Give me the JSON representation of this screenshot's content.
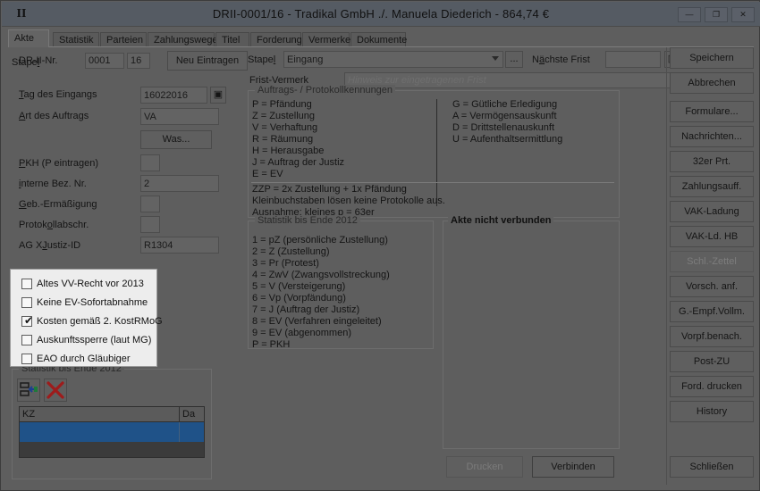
{
  "window": {
    "title": "DRII-0001/16 - Tradikal GmbH ./. Manuela Diederich - 864,74 €",
    "pin_icon": "II",
    "controls": {
      "minimize": "—",
      "maximize": "❐",
      "close": "✕"
    }
  },
  "tabs": [
    {
      "label": "Akte",
      "active": true
    },
    {
      "label": "Statistik",
      "active": false
    },
    {
      "label": "Parteien",
      "active": false
    },
    {
      "label": "Zahlungswege",
      "active": false
    },
    {
      "label": "Titel",
      "active": false
    },
    {
      "label": "Forderung",
      "active": false
    },
    {
      "label": "Vermerke",
      "active": false
    },
    {
      "label": "Dokumente",
      "active": false
    }
  ],
  "form": {
    "drii_label": "DR-II-Nr.",
    "drii_no": "0001",
    "drii_year": "16",
    "neu_eintragen": "Neu Eintragen",
    "tag_eingangs_label": "Tag des Eingangs",
    "tag_eingangs_value": "16022016",
    "art_auftrags_label": "Art des Auftrags",
    "art_auftrags_value": "VA",
    "was_button": "Was...",
    "pkh_label": "PKH (P eintragen)",
    "pkh_value": "",
    "interne_bez_label": "interne Bez. Nr.",
    "interne_bez_value": "2",
    "geb_ermaessigung_label": "Geb.-Ermäßigung",
    "geb_ermaessigung_value": "",
    "protokollabschr_label": "Protokollabschr.",
    "protokollabschr_value": "",
    "ag_xjustiz_label": "AG XJustiz-ID",
    "ag_xjustiz_value": "R1304"
  },
  "stapel": {
    "label": "Stapel",
    "value": "Eingang",
    "ellipsis_button": "...",
    "naechste_frist_label": "Nächste Frist",
    "naechste_frist_value": "",
    "calendar_icon": "calendar-icon"
  },
  "frist_vermerk": {
    "label": "Frist-Vermerk",
    "placeholder": "Hinweis zur eingetragenen Frist",
    "value": ""
  },
  "kennungen": {
    "title": "Auftrags- / Protokollkennungen",
    "left_column": [
      "P = Pfändung",
      "Z = Zustellung",
      "V = Verhaftung",
      "R = Räumung",
      "H = Herausgabe",
      "J = Auftrag der Justiz",
      "E = EV"
    ],
    "right_column": [
      "G = Gütliche Erledigung",
      "A = Vermögensauskunft",
      "D = Drittstellenauskunft",
      "U = Aufenthaltsermittlung"
    ],
    "footnotes": [
      "ZZP = 2x Zustellung + 1x Pfändung",
      "Kleinbuchstaben lösen keine Protokolle aus.",
      "Ausnahme: kleines p = 63er"
    ]
  },
  "statistik_legend": {
    "title": "Statistik bis Ende 2012",
    "lines": [
      "1 = pZ (persönliche Zustellung)",
      "2 = Z (Zustellung)",
      "3 = Pr (Protest)",
      "4 = ZwV (Zwangsvollstreckung)",
      "5 = V (Versteigerung)",
      "6 = Vp (Vorpfändung)",
      "7 = J (Auftrag der Justiz)",
      "8 = EV (Verfahren eingeleitet)",
      "9 = EV (abgenommen)",
      "P = PKH"
    ]
  },
  "akte_panel": {
    "title": "Akte nicht verbunden",
    "drucken_button": "Drucken",
    "drucken_enabled": false,
    "verbinden_button": "Verbinden",
    "verbinden_enabled": true
  },
  "statistik_grid": {
    "title": "Statistik bis Ende 2012",
    "toolbar": [
      {
        "icon": "insert-row-icon",
        "name": "insert-row-button"
      },
      {
        "icon": "delete-row-icon",
        "name": "delete-row-button"
      }
    ],
    "columns": [
      "KZ",
      "Da"
    ],
    "rows": [
      {
        "kz": "",
        "da": "",
        "selected": true
      }
    ]
  },
  "popup_options": {
    "items": [
      {
        "label": "Altes VV-Recht vor 2013",
        "checked": false
      },
      {
        "label": "Keine EV-Sofortabnahme",
        "checked": false
      },
      {
        "label": "Kosten gemäß 2. KostRMoG",
        "checked": true
      },
      {
        "label": "Auskunftssperre (laut MG)",
        "checked": false
      },
      {
        "label": "EAO durch Gläubiger",
        "checked": false
      }
    ],
    "check_glyph": "✔"
  },
  "sidebar": {
    "buttons": [
      {
        "label": "Speichern",
        "enabled": true
      },
      {
        "label": "Abbrechen",
        "enabled": true
      },
      {
        "label": "Formulare...",
        "enabled": true
      },
      {
        "label": "Nachrichten...",
        "enabled": true
      },
      {
        "label": "32er Prt.",
        "enabled": true
      },
      {
        "label": "Zahlungsauff.",
        "enabled": true
      },
      {
        "label": "VAK-Ladung",
        "enabled": true
      },
      {
        "label": "VAK-Ld. HB",
        "enabled": true
      },
      {
        "label": "Schl.-Zettel",
        "enabled": false
      },
      {
        "label": "Vorsch. anf.",
        "enabled": true
      },
      {
        "label": "G.-Empf.Vollm.",
        "enabled": true
      },
      {
        "label": "Vorpf.benach.",
        "enabled": true
      },
      {
        "label": "Post-ZU",
        "enabled": true
      },
      {
        "label": "Ford. drucken",
        "enabled": true
      },
      {
        "label": "History",
        "enabled": true
      }
    ],
    "close_button": {
      "label": "Schließen",
      "enabled": true
    }
  },
  "colors": {
    "window_bg": "#5e5e5e",
    "titlebar_bg": "#555b63",
    "field_bg": "#636363",
    "selection_blue": "#1f5288",
    "popup_bg": "#ededed",
    "delete_icon_red": "#9e1b1b"
  }
}
